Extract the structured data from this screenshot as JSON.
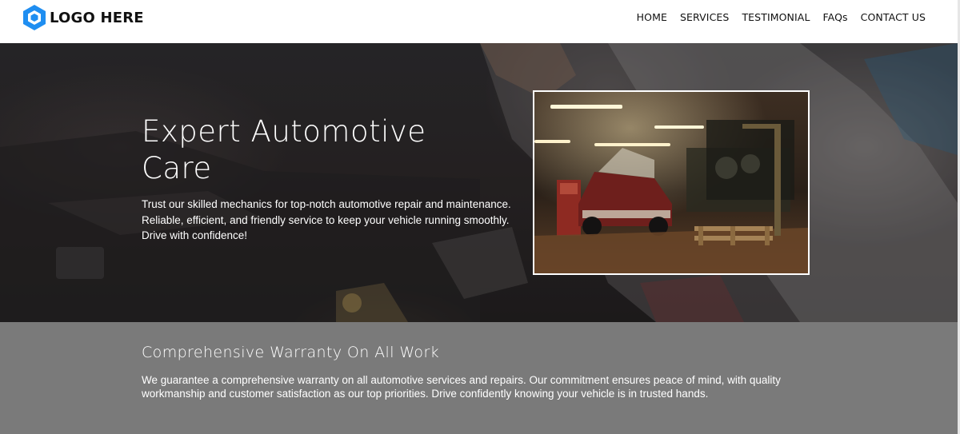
{
  "header": {
    "logo_text": "LOGO HERE",
    "nav": [
      "HOME",
      "SERVICES",
      "TESTIMONIAL",
      "FAQs",
      "CONTACT US"
    ]
  },
  "hero": {
    "title": "Expert Automotive Care",
    "description": "Trust our skilled mechanics for top-notch automotive repair and maintenance. Reliable, efficient, and friendly service to keep your vehicle running smoothly. Drive with confidence!"
  },
  "warranty": {
    "title": "Comprehensive Warranty On All Work",
    "description": "We guarantee a comprehensive warranty on all automotive services and repairs. Our commitment ensures peace of mind, with quality workmanship and customer satisfaction as our top priorities. Drive confidently knowing your vehicle is in trusted hands."
  },
  "colors": {
    "logo_blue": "#1f8ef1",
    "warranty_bg": "#7a7a7a"
  }
}
